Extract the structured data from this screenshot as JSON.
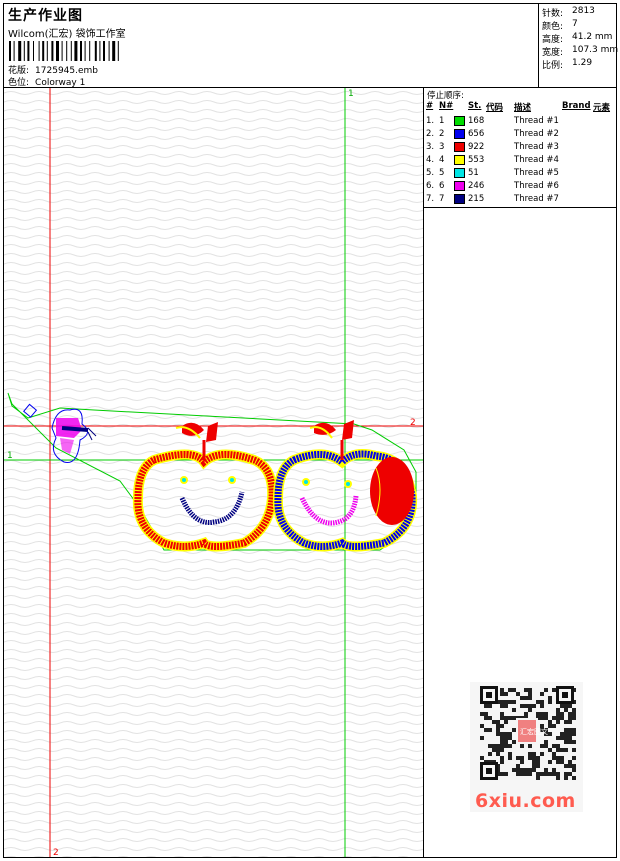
{
  "header": {
    "title": "生产作业图",
    "subtitle": "Wilcom(汇宏) 袋饰工作室",
    "design_label": "花版:",
    "design_value": "1725945.emb",
    "colorway_label": "色位:",
    "colorway_value": "Colorway 1"
  },
  "stats": [
    {
      "label": "针数:",
      "value": "2813"
    },
    {
      "label": "颜色:",
      "value": "7"
    },
    {
      "label": "高度:",
      "value": "41.2 mm"
    },
    {
      "label": "宽度:",
      "value": "107.3 mm"
    },
    {
      "label": "比例:",
      "value": "1.29"
    }
  ],
  "stop_sequence": {
    "title": "停止顺序:",
    "columns": {
      "num": "#",
      "n": "N#",
      "st": "St.",
      "code": "代码",
      "desc": "描述",
      "brand": "Brand",
      "element": "元素"
    },
    "rows": [
      {
        "num": "1.",
        "n": "1",
        "color": "#00dd00",
        "code": "168",
        "desc": "Thread #1"
      },
      {
        "num": "2.",
        "n": "2",
        "color": "#0000ee",
        "code": "656",
        "desc": "Thread #2"
      },
      {
        "num": "3.",
        "n": "3",
        "color": "#ee0000",
        "code": "922",
        "desc": "Thread #3"
      },
      {
        "num": "4.",
        "n": "4",
        "color": "#ffff00",
        "code": "553",
        "desc": "Thread #4"
      },
      {
        "num": "5.",
        "n": "5",
        "color": "#00e5e5",
        "code": "51",
        "desc": "Thread #5"
      },
      {
        "num": "6.",
        "n": "6",
        "color": "#ee00ee",
        "code": "246",
        "desc": "Thread #6"
      },
      {
        "num": "7.",
        "n": "7",
        "color": "#000080",
        "code": "215",
        "desc": "Thread #7"
      }
    ]
  },
  "guides": {
    "green_v_label": "1",
    "green_h_label": "1",
    "red_h_label": "2",
    "red_v_label": "2"
  },
  "watermark": {
    "site": "6xiu.com",
    "seal_text": "汇宏图文"
  },
  "colors": {
    "green": "#00cc00",
    "red": "#ee0000"
  }
}
